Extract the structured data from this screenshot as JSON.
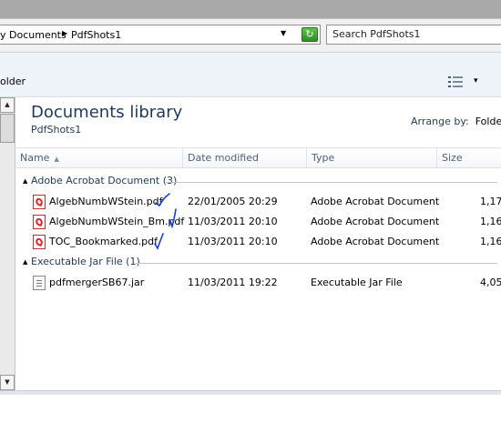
{
  "address": {
    "breadcrumbs": [
      "y Documents",
      "PdfShots1"
    ],
    "search_placeholder": "Search PdfShots1",
    "refresh_label": "↻"
  },
  "toolbar": {
    "folder_label": "older",
    "view_icon": "details-view-icon",
    "dropdown_label": "▾"
  },
  "library": {
    "title": "Documents library",
    "subtitle": "PdfShots1",
    "arrange_label": "Arrange by:",
    "arrange_value": "Folde"
  },
  "columns": {
    "name": "Name",
    "date": "Date modified",
    "type": "Type",
    "size": "Size"
  },
  "groups": [
    {
      "label": "Adobe Acrobat Document (3)",
      "files": [
        {
          "name": "AlgebNumbWStein.pdf",
          "date": "22/01/2005 20:29",
          "type": "Adobe Acrobat Document",
          "size": "1,17",
          "icon": "pdf-icon",
          "checked": true
        },
        {
          "name": "AlgebNumbWStein_Bm.pdf",
          "date": "11/03/2011 20:10",
          "type": "Adobe Acrobat Document",
          "size": "1,16",
          "icon": "pdf-icon",
          "checked": true
        },
        {
          "name": "TOC_Bookmarked.pdf",
          "date": "11/03/2011 20:10",
          "type": "Adobe Acrobat Document",
          "size": "1,16",
          "icon": "pdf-icon",
          "checked": true
        }
      ]
    },
    {
      "label": "Executable Jar File (1)",
      "files": [
        {
          "name": "pdfmergerSB67.jar",
          "date": "11/03/2011 19:22",
          "type": "Executable Jar File",
          "size": "4,05",
          "icon": "jar-icon",
          "checked": false
        }
      ]
    }
  ],
  "colors": {
    "accent_text": "#1e395b",
    "handwritten_check": "#1a3bd6"
  }
}
